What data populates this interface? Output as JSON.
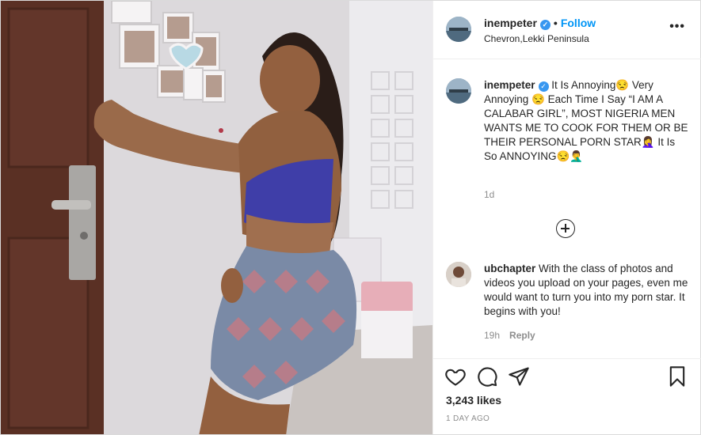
{
  "post": {
    "username": "inempeter",
    "verified_badge": "✓",
    "separator": "•",
    "follow_label": "Follow",
    "location": "Chevron,Lekki Peninsula",
    "more_label": "•••"
  },
  "caption": {
    "username": "inempeter",
    "text": "It Is Annoying😒 Very Annoying 😒 Each Time I Say “I AM A CALABAR GIRL”, MOST NIGERIA MEN WANTS ME TO COOK FOR THEM OR BE THEIR PERSONAL PORN STAR🤦‍♀️ It Is So ANNOYING😒🤦‍♂️",
    "age": "1d"
  },
  "comments": [
    {
      "username": "ubchapter",
      "text": "With the class of photos and videos you upload on your pages, even me would want to turn you into my porn star. It begins with you!",
      "age": "19h",
      "reply_label": "Reply"
    }
  ],
  "actions": {
    "like_icon": "heart-icon",
    "comment_icon": "comment-icon",
    "share_icon": "paper-plane-icon",
    "save_icon": "bookmark-icon"
  },
  "likes_text": "3,243 likes",
  "timestamp": "1 DAY AGO",
  "colors": {
    "follow": "#0095f6",
    "verified": "#3897f0",
    "muted": "#8e8e8e",
    "text": "#262626"
  }
}
